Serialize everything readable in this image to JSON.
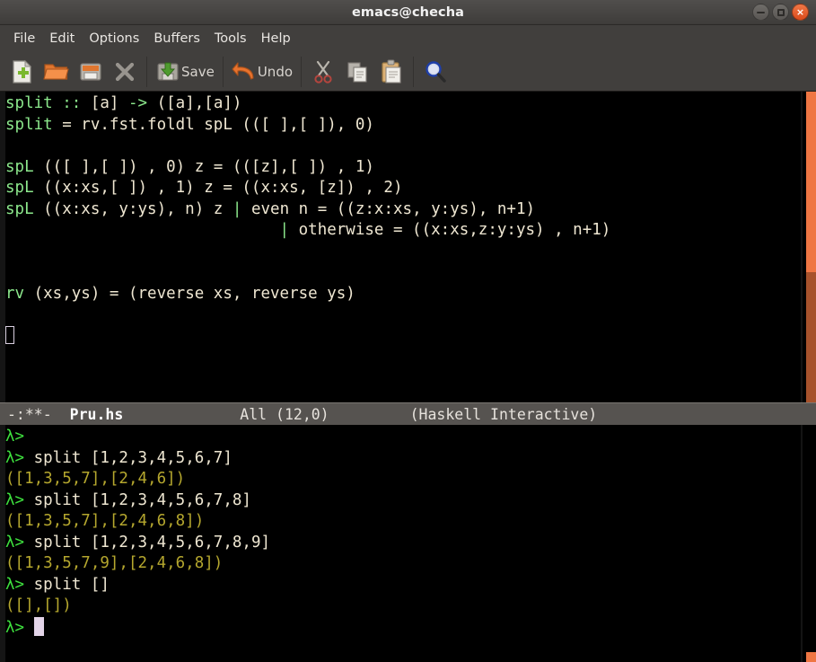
{
  "window": {
    "title": "emacs@checha",
    "controls": [
      {
        "name": "minimize-button",
        "label": ""
      },
      {
        "name": "maximize-button",
        "label": ""
      },
      {
        "name": "close-button",
        "label": "×"
      }
    ]
  },
  "menubar": {
    "items": [
      {
        "label": "File"
      },
      {
        "label": "Edit"
      },
      {
        "label": "Options"
      },
      {
        "label": "Buffers"
      },
      {
        "label": "Tools"
      },
      {
        "label": "Help"
      }
    ]
  },
  "toolbar": {
    "buttons": [
      {
        "icon": "new-file-icon",
        "label": ""
      },
      {
        "icon": "open-folder-icon",
        "label": ""
      },
      {
        "icon": "save-as-icon",
        "label": ""
      },
      {
        "icon": "close-buffer-icon",
        "label": ""
      },
      {
        "icon": "save-icon",
        "label": "Save"
      },
      {
        "icon": "undo-icon",
        "label": "Undo"
      },
      {
        "icon": "cut-scissors-icon",
        "label": ""
      },
      {
        "icon": "copy-icon",
        "label": ""
      },
      {
        "icon": "paste-icon",
        "label": ""
      },
      {
        "icon": "search-magnifier-icon",
        "label": ""
      }
    ]
  },
  "code_buffer": {
    "lines": [
      [
        {
          "t": "split",
          "c": "g"
        },
        {
          "t": " ",
          "c": "plain"
        },
        {
          "t": "::",
          "c": "g"
        },
        {
          "t": " [a] ",
          "c": "plain"
        },
        {
          "t": "->",
          "c": "g"
        },
        {
          "t": " ([a],[a])",
          "c": "plain"
        }
      ],
      [
        {
          "t": "split",
          "c": "g"
        },
        {
          "t": " = rv.fst.foldl spL (([ ],[ ]), 0)",
          "c": "plain"
        }
      ],
      [
        {
          "t": "",
          "c": "plain"
        }
      ],
      [
        {
          "t": "spL",
          "c": "g"
        },
        {
          "t": " (([ ],[ ]) , 0) z = (([z],[ ]) , 1)",
          "c": "plain"
        }
      ],
      [
        {
          "t": "spL",
          "c": "g"
        },
        {
          "t": " ((x:xs,[ ]) , 1) z = ((x:xs, [z]) , 2)",
          "c": "plain"
        }
      ],
      [
        {
          "t": "spL",
          "c": "g"
        },
        {
          "t": " ((x:xs, y:ys), n) z ",
          "c": "plain"
        },
        {
          "t": "|",
          "c": "g"
        },
        {
          "t": " even n = ((z:x:xs, y:ys), n+1)",
          "c": "plain"
        }
      ],
      [
        {
          "t": "                             ",
          "c": "plain"
        },
        {
          "t": "|",
          "c": "g"
        },
        {
          "t": " otherwise = ((x:xs,z:y:ys) , n+1)",
          "c": "plain"
        }
      ],
      [
        {
          "t": "",
          "c": "plain"
        }
      ],
      [
        {
          "t": "",
          "c": "plain"
        }
      ],
      [
        {
          "t": "rv",
          "c": "g"
        },
        {
          "t": " (xs,ys) = (reverse xs, reverse ys)",
          "c": "plain"
        }
      ],
      [
        {
          "t": "",
          "c": "plain"
        }
      ],
      [
        {
          "t": "",
          "c": "cursor-hollow"
        }
      ]
    ]
  },
  "modeline": {
    "flags": "-:**-",
    "buffer": "Pru.hs",
    "position": "All (12,0)",
    "mode": "(Haskell Interactive)"
  },
  "repl_buffer": {
    "prompt": "λ>",
    "lines": [
      {
        "kind": "prompt",
        "input": ""
      },
      {
        "kind": "prompt",
        "input": " split [1,2,3,4,5,6,7]"
      },
      {
        "kind": "output",
        "text": "([1,3,5,7],[2,4,6])"
      },
      {
        "kind": "prompt",
        "input": " split [1,2,3,4,5,6,7,8]"
      },
      {
        "kind": "output",
        "text": "([1,3,5,7],[2,4,6,8])"
      },
      {
        "kind": "prompt",
        "input": " split [1,2,3,4,5,6,7,8,9]"
      },
      {
        "kind": "output",
        "text": "([1,3,5,7,9],[2,4,6,8])"
      },
      {
        "kind": "prompt",
        "input": " split []"
      },
      {
        "kind": "output",
        "text": "([],[])"
      },
      {
        "kind": "prompt-cursor",
        "input": " "
      }
    ]
  },
  "colors": {
    "background": "#000000",
    "foreground": "#efe7d2",
    "keyword_green": "#8ce88c",
    "prompt_green": "#3ee03e",
    "output_olive": "#b5a72e",
    "modeline_bg": "#565350",
    "chrome_bg": "#413f3d",
    "scrollbar_thumb": "#ef7643",
    "scrollbar_shadow": "#a7522c",
    "close_button": "#e05420"
  },
  "scrollbars": {
    "code": {
      "thumb_top_pct": 0,
      "thumb_height_pct": 58
    },
    "repl": {
      "thumb_top_pct": 96,
      "thumb_height_pct": 4
    }
  }
}
